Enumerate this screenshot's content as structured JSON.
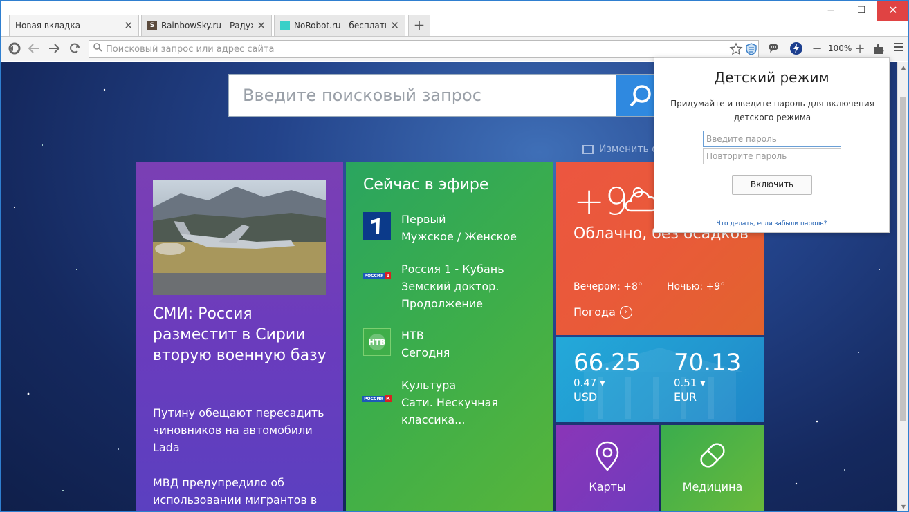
{
  "tabs": [
    {
      "title": "Новая вкладка",
      "favicon": "none",
      "active": true
    },
    {
      "title": "RainbowSky.ru - Радужн",
      "favicon": "S",
      "favicon_color": "#5b4a3c"
    },
    {
      "title": "NoRobot.ru - бесплатно",
      "favicon": "",
      "favicon_color": "#39d0c8"
    }
  ],
  "new_tab_label": "+",
  "window_controls": {
    "minimize": "−",
    "maximize": "☐",
    "close": "✕"
  },
  "toolbar": {
    "address_placeholder": "Поисковый запрос или адрес сайта",
    "zoom": "100%",
    "zoom_out": "−",
    "zoom_in": "+"
  },
  "search": {
    "placeholder": "Введите поисковый запрос"
  },
  "change_background": "Изменить ф",
  "news": {
    "headline": "СМИ: Россия разместит в Сирии вторую военную базу",
    "items": [
      "Путину обещают пересадить чиновников на автомобили Lada",
      "МВД предупредило об использовании мигрантов в"
    ]
  },
  "tv": {
    "heading": "Сейчас в эфире",
    "channels": [
      {
        "channel": "Первый",
        "program": "Мужское / Женское",
        "logo": "1"
      },
      {
        "channel": "Россия 1 - Кубань",
        "program": "Земский доктор. Продолжение",
        "logo": "РОССИЯ 1"
      },
      {
        "channel": "НТВ",
        "program": "Сегодня",
        "logo": "НТВ"
      },
      {
        "channel": "Культура",
        "program": "Сати. Нескучная классика...",
        "logo": "РОССИЯ К"
      }
    ]
  },
  "weather": {
    "temp": "+9°",
    "desc": "Облачно, без осадков",
    "evening": "Вечером: +8°",
    "night": "Ночью: +9°",
    "link": "Погода"
  },
  "currency": {
    "usd": {
      "rate": "66.25",
      "change": "0.47 ▾",
      "code": "USD"
    },
    "eur": {
      "rate": "70.13",
      "change": "0.51 ▾",
      "code": "EUR"
    }
  },
  "tiles_small": {
    "maps": "Карты",
    "medicine": "Медицина"
  },
  "popup": {
    "title": "Детский режим",
    "text": "Придумайте и введите пароль для включения детского режима",
    "password_placeholder": "Введите пароль",
    "repeat_placeholder": "Повторите пароль",
    "enable_button": "Включить",
    "forgot_link": "Что делать, если забыли пароль?"
  }
}
